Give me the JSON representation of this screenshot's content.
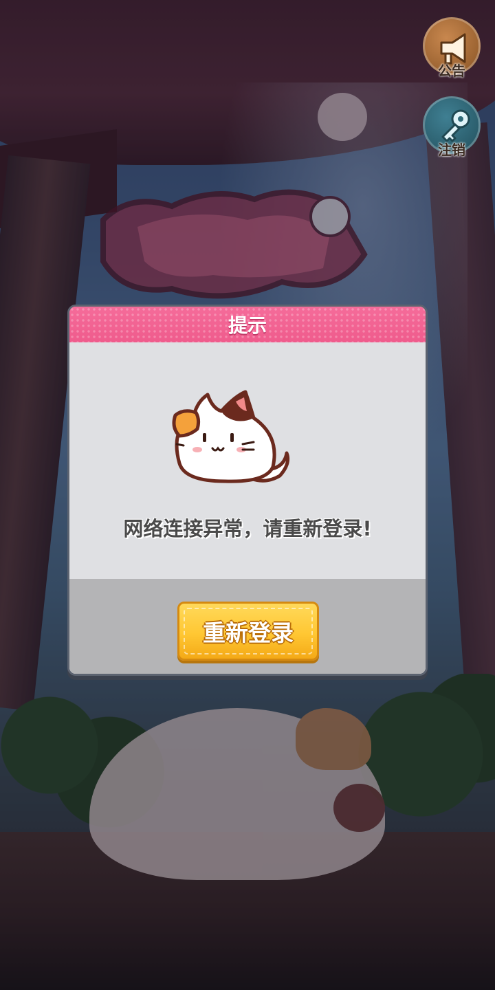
{
  "side_buttons": {
    "notice_label": "公告",
    "logout_label": "注销"
  },
  "dialog": {
    "title": "提示",
    "message": "网络连接异常，请重新登录!",
    "button_label": "重新登录"
  },
  "colors": {
    "header_pink": "#f56c9a",
    "button_yellow": "#ffc733",
    "notice_icon_bg": "#c8874e",
    "logout_icon_bg": "#3f7f92"
  },
  "icons": [
    "megaphone-icon",
    "key-icon",
    "cat-mascot-illustration"
  ]
}
